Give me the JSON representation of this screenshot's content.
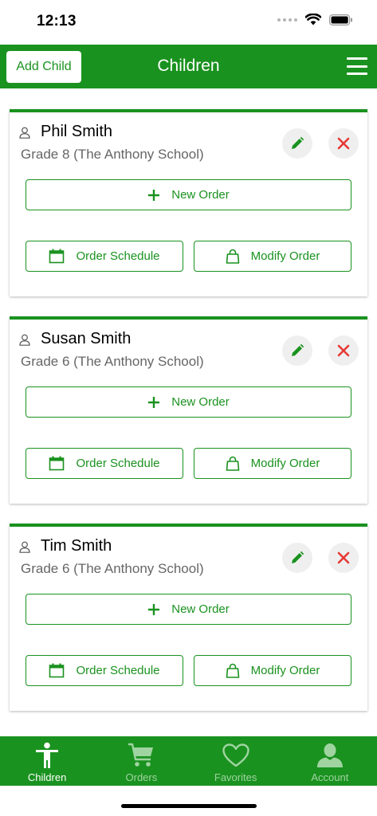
{
  "status_bar": {
    "time": "12:13"
  },
  "header": {
    "add_child_label": "Add Child",
    "title": "Children"
  },
  "children": [
    {
      "name": "Phil Smith",
      "grade": "Grade 8 (The Anthony School)"
    },
    {
      "name": "Susan Smith",
      "grade": "Grade 6 (The Anthony School)"
    },
    {
      "name": "Tim Smith",
      "grade": "Grade 6 (The Anthony School)"
    }
  ],
  "card_actions": {
    "new_order": "New Order",
    "order_schedule": "Order Schedule",
    "modify_order": "Modify Order"
  },
  "tabs": [
    {
      "label": "Children",
      "icon": "child-icon",
      "active": true
    },
    {
      "label": "Orders",
      "icon": "cart-icon",
      "active": false
    },
    {
      "label": "Favorites",
      "icon": "heart-icon",
      "active": false
    },
    {
      "label": "Account",
      "icon": "account-icon",
      "active": false
    }
  ],
  "colors": {
    "brand_green": "#1a921f",
    "delete_red": "#e53935",
    "inactive_tab": "#9fd4a1"
  }
}
